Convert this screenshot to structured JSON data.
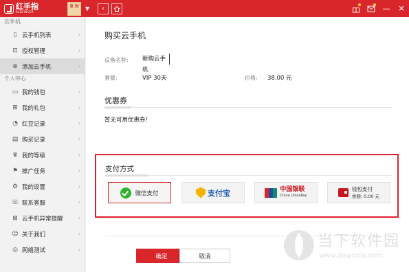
{
  "app": {
    "logo_cn": "红手指",
    "logo_en": "REDFINGER",
    "avatar_text": "发 财"
  },
  "sidebar": {
    "section_cloud": "云手机",
    "cloud_items": [
      {
        "label": "云手机列表",
        "icon": "phone-icon"
      },
      {
        "label": "授权管理",
        "icon": "authorize-icon"
      },
      {
        "label": "添加云手机",
        "icon": "add-circle-icon"
      }
    ],
    "section_personal": "个人中心",
    "personal_items": [
      {
        "label": "我的钱包",
        "icon": "wallet-icon"
      },
      {
        "label": "我的礼包",
        "icon": "gift-icon"
      },
      {
        "label": "红豆记录",
        "icon": "bean-icon"
      },
      {
        "label": "购买记录",
        "icon": "purchase-icon"
      },
      {
        "label": "我的等级",
        "icon": "crown-icon"
      },
      {
        "label": "推广任务",
        "icon": "flag-icon"
      },
      {
        "label": "我的设置",
        "icon": "gear-icon"
      },
      {
        "label": "联系客服",
        "icon": "service-icon"
      },
      {
        "label": "云手机异常提醒",
        "icon": "alert-icon"
      },
      {
        "label": "关于我们",
        "icon": "smile-icon"
      },
      {
        "label": "网络测试",
        "icon": "network-icon"
      }
    ]
  },
  "main": {
    "title": "购买云手机",
    "device_name_label": "设备名称:",
    "device_name_value": "新购云手机",
    "package_label": "套餐:",
    "package_value": "VIP 30天",
    "price_label": "价格:",
    "price_value": "38.00 元",
    "coupon_title": "优惠券",
    "coupon_empty": "暂无可用优惠券!",
    "payment_title": "支付方式",
    "payment_options": {
      "wechat": "微信支付",
      "alipay": "支付宝",
      "unionpay_cn": "中国银联",
      "unionpay_en": "China UnionPay",
      "wallet": "钱包支付",
      "wallet_balance": "余额: 0.00 元"
    },
    "confirm_label": "确定",
    "cancel_label": "取消"
  },
  "watermark": {
    "cn": "当下软件园",
    "url": "www.downxia.com"
  },
  "colors": {
    "brand_red": "#d8262a",
    "selected_border": "#e0202a",
    "wechat_green": "#2fb32c",
    "alipay_blue": "#1a5fb4"
  }
}
